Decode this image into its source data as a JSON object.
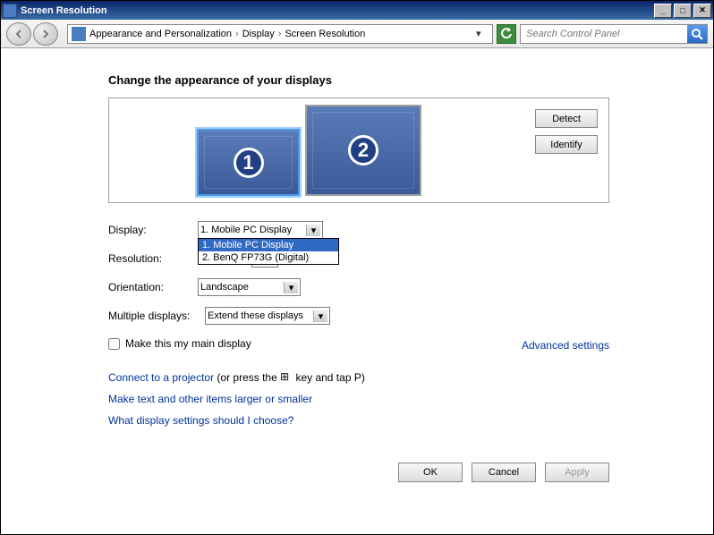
{
  "window": {
    "title": "Screen Resolution"
  },
  "breadcrumb": {
    "items": [
      "Appearance and Personalization",
      "Display",
      "Screen Resolution"
    ]
  },
  "search": {
    "placeholder": "Search Control Panel"
  },
  "page": {
    "heading": "Change the appearance of your displays"
  },
  "monitor_buttons": {
    "detect": "Detect",
    "identify": "Identify"
  },
  "monitors": [
    {
      "number": "1",
      "selected": true
    },
    {
      "number": "2",
      "selected": false
    }
  ],
  "settings": {
    "display_label": "Display:",
    "display_value": "1. Mobile PC Display",
    "display_options": [
      "1. Mobile PC Display",
      "2. BenQ FP73G (Digital)"
    ],
    "resolution_label": "Resolution:",
    "orientation_label": "Orientation:",
    "orientation_value": "Landscape",
    "multi_label": "Multiple displays:",
    "multi_value": "Extend these displays"
  },
  "checkbox": {
    "label": "Make this my main display"
  },
  "advanced": "Advanced settings",
  "links": {
    "projector_link": "Connect to a projector",
    "projector_rest": " (or press the ",
    "projector_rest2": " key and tap P)",
    "text_size": "Make text and other items larger or smaller",
    "help": "What display settings should I choose?"
  },
  "buttons": {
    "ok": "OK",
    "cancel": "Cancel",
    "apply": "Apply"
  }
}
